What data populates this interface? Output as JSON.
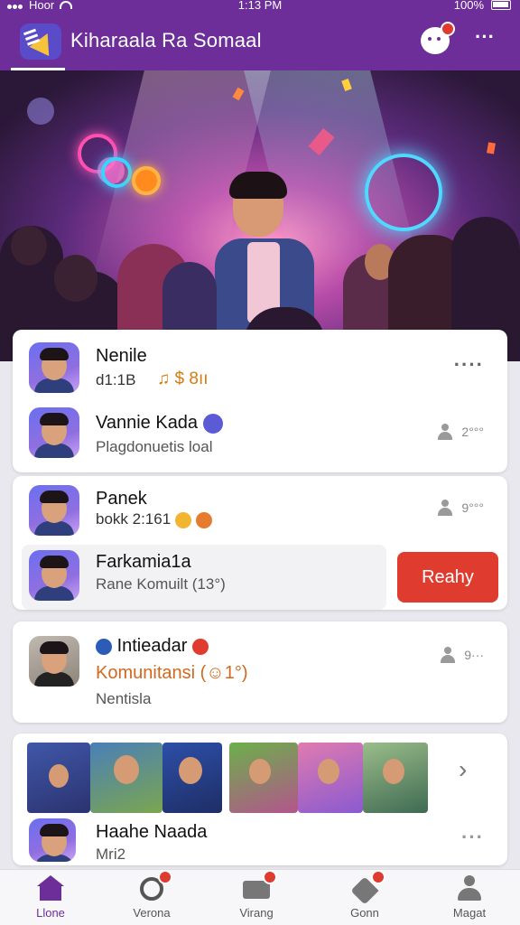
{
  "status_bar": {
    "carrier": "Hoor",
    "time": "1:13 PM",
    "battery": "100%"
  },
  "header": {
    "title": "Kiharaala Ra Somaal"
  },
  "cards": [
    {
      "name": "Nenile",
      "sub": "d1:1B",
      "extra": "♫ $ 8ıı"
    },
    {
      "name": "Vannie Kada",
      "sub": "Plagdonuetis loal",
      "meta": "2°°°"
    },
    {
      "name": "Panek",
      "sub": "bokk 2:161",
      "meta": "9°°°"
    },
    {
      "name": "Farkamia1a",
      "sub": "Rane Komuilt (13°)",
      "action": "Reahy"
    },
    {
      "name": "Intieadar",
      "orange": "Komunitansi (☺1°)",
      "sub": "Nentisla",
      "meta": "9···"
    },
    {
      "name": "Haahe Naada",
      "sub": "Mri2"
    }
  ],
  "bottom_nav": [
    {
      "label": "Llone",
      "icon": "home-icon",
      "active": true
    },
    {
      "label": "Verona",
      "icon": "music-icon"
    },
    {
      "label": "Virang",
      "icon": "mail-icon"
    },
    {
      "label": "Gonn",
      "icon": "heart-icon"
    },
    {
      "label": "Magat",
      "icon": "profile-icon"
    }
  ],
  "colors": {
    "brand": "#6d2e9a",
    "alert": "#e03b2f",
    "orange": "#d2691e"
  }
}
